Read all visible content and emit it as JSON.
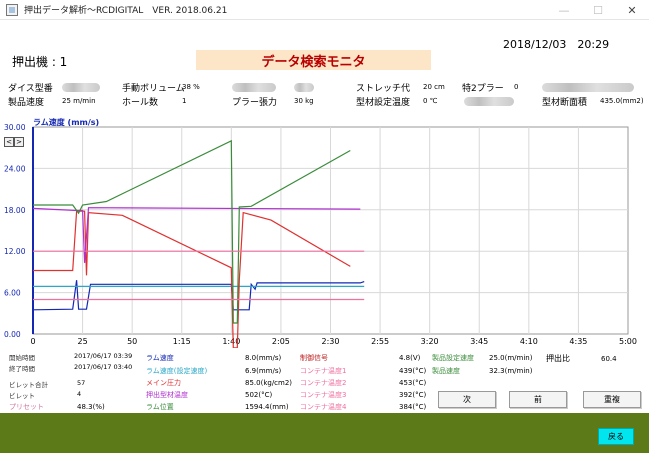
{
  "window": {
    "title": "押出データ解析～RCDIGITAL　VER. 2018.06.21",
    "minimize": "—",
    "maximize": "☐",
    "close": "✕"
  },
  "header": {
    "machine": "押出機 : 1",
    "banner": "データ検索モニタ",
    "datetime": "2018/12/03　20:29"
  },
  "info": {
    "die_label": "ダイス型番",
    "speed_label": "製品速度",
    "speed_value": "25 m/min",
    "manual_label": "手動ボリューム",
    "manual_value": "38 %",
    "holes_label": "ホール数",
    "holes_value": "1",
    "puller_label": "プラー張力",
    "puller_value": "30 kg",
    "stretch_label": "ストレッチ代",
    "stretch_value": "20 cm",
    "special_label": "特2プラー",
    "special_value": "0",
    "mold_temp_label": "型材設定温度",
    "mold_temp_value": "0 ℃",
    "area_label": "型材断面積",
    "area_value": "435.0(mm2)"
  },
  "chart_data": {
    "type": "line",
    "title": "ラム速度 (mm/s)",
    "ylim": [
      0,
      30
    ],
    "xlim_seconds": [
      0,
      300
    ],
    "y_ticks": [
      "0.00",
      "6.00",
      "12.00",
      "18.00",
      "24.00",
      "30.00"
    ],
    "x_ticks": [
      "0",
      "25",
      "50",
      "1:15",
      "1:40",
      "2:05",
      "2:30",
      "2:55",
      "3:20",
      "3:45",
      "4:10",
      "4:35",
      "5:00"
    ],
    "grid": true,
    "series": [
      {
        "name": "ラム速度",
        "color": "#1428b4",
        "points": [
          [
            0,
            3.5
          ],
          [
            20,
            3.6
          ],
          [
            22,
            7.8
          ],
          [
            23,
            3.6
          ],
          [
            27,
            3.6
          ],
          [
            29,
            7.2
          ],
          [
            30,
            7.2
          ],
          [
            100,
            7.2
          ],
          [
            101,
            3.5
          ],
          [
            109,
            3.5
          ],
          [
            110,
            7.2
          ],
          [
            112,
            6.5
          ],
          [
            113,
            7.4
          ],
          [
            165,
            7.4
          ],
          [
            167,
            7.6
          ]
        ]
      },
      {
        "name": "ラム速度(設定速度)",
        "color": "#2aa8c8",
        "points": [
          [
            0,
            6.9
          ],
          [
            167,
            6.9
          ]
        ]
      },
      {
        "name": "メイン圧力",
        "color": "#e03030",
        "points": [
          [
            0,
            9.2
          ],
          [
            20,
            9.2
          ],
          [
            22,
            17.8
          ],
          [
            26,
            17.8
          ],
          [
            27,
            8.5
          ],
          [
            28,
            17.6
          ],
          [
            45,
            17.2
          ],
          [
            100,
            9.6
          ],
          [
            101,
            -2
          ],
          [
            103,
            -2
          ],
          [
            104,
            7.8
          ],
          [
            106,
            17.6
          ],
          [
            120,
            16.5
          ],
          [
            160,
            9.8
          ]
        ]
      },
      {
        "name": "押出型材温度",
        "color": "#b030d0",
        "points": [
          [
            0,
            18.2
          ],
          [
            22,
            17.9
          ],
          [
            25,
            17.9
          ],
          [
            26,
            10.3
          ],
          [
            28,
            18.3
          ],
          [
            165,
            18.1
          ]
        ]
      },
      {
        "name": "ラム位置",
        "color": "#3a8c3a",
        "points": [
          [
            0,
            18.7
          ],
          [
            20,
            18.7
          ],
          [
            23,
            17.5
          ],
          [
            25,
            18.7
          ],
          [
            37,
            19.2
          ],
          [
            100,
            28.0
          ],
          [
            101,
            1.6
          ],
          [
            103,
            1.6
          ],
          [
            104,
            18.4
          ],
          [
            110,
            18.5
          ],
          [
            160,
            26.6
          ]
        ]
      },
      {
        "name": "コンテナ温度1",
        "color": "#f070a0",
        "points": [
          [
            0,
            12.0
          ],
          [
            167,
            12.0
          ]
        ]
      },
      {
        "name": "コンテナ温度2",
        "color": "#f070a0",
        "points": [
          [
            0,
            5.0
          ],
          [
            167,
            5.0
          ]
        ]
      }
    ]
  },
  "stats": {
    "start_label": "開始時間",
    "start_value": "2017/06/17 03:39",
    "end_label": "終了時間",
    "end_value": "2017/06/17 03:40",
    "billet_total_label": "ビレット合計",
    "billet_total_value": "57",
    "billet_label": "ビレット",
    "billet_value": "4",
    "preset_label": "プリセット",
    "preset_value": "48.3(%)",
    "ram_speed_label": "ラム速度",
    "ram_speed_value": "8.0(mm/s)",
    "ram_set_label": "ラム速度(設定速度)",
    "ram_set_value": "6.9(mm/s)",
    "main_pressure_label": "メイン圧力",
    "main_pressure_value": "85.0(kg/cm2)",
    "extrude_temp_label": "押出型材温度",
    "extrude_temp_value": "502(°C)",
    "ram_pos_label": "ラム位置",
    "ram_pos_value": "1594.4(mm)",
    "control_label": "制御信号",
    "control_value": "4.8(V)",
    "cont1_label": "コンテナ温度1",
    "cont1_value": "439(°C)",
    "cont2_label": "コンテナ温度2",
    "cont2_value": "453(°C)",
    "cont3_label": "コンテナ温度3",
    "cont3_value": "392(°C)",
    "cont4_label": "コンテナ温度4",
    "cont4_value": "384(°C)",
    "prod_set_label": "製品設定速度",
    "prod_set_value": "25.0(m/min)",
    "prod_speed_label": "製品速度",
    "prod_speed_value": "32.3(m/min)",
    "ratio_label": "押出比",
    "ratio_value": "60.4"
  },
  "buttons": {
    "next": "次",
    "prev": "前",
    "overlay": "重複",
    "back": "戻る",
    "scroll_left": "<",
    "scroll_right": ">"
  }
}
